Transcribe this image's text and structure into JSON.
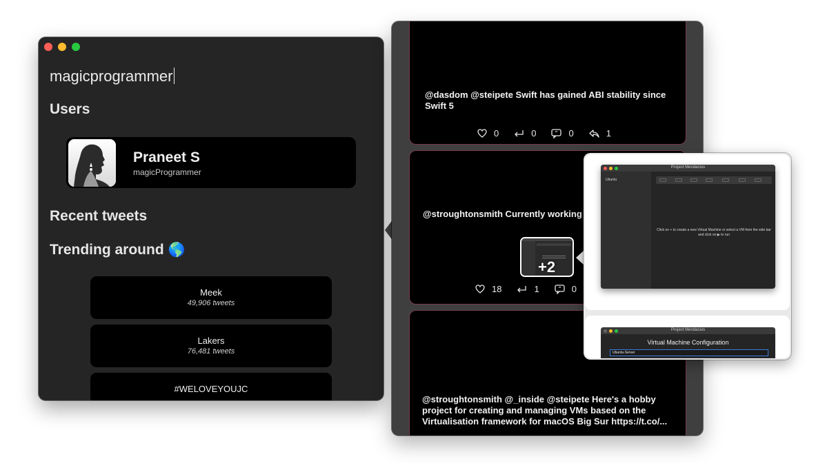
{
  "search": {
    "query": "magicprogrammer"
  },
  "sections": {
    "users": "Users",
    "recent_tweets": "Recent tweets",
    "trending": "Trending around",
    "trending_emoji": "🌎"
  },
  "user": {
    "name": "Praneet S",
    "handle": "magicProgrammer"
  },
  "trends": [
    {
      "name": "Meek",
      "count": "49,906 tweets"
    },
    {
      "name": "Lakers",
      "count": "76,481 tweets"
    },
    {
      "name": "#WELOVEYOUJC",
      "count": ""
    }
  ],
  "tweets": [
    {
      "text": "@dasdom @steipete Swift has gained ABI stability since Swift 5",
      "likes": "0",
      "retweets": "0",
      "quotes": "0",
      "replies": "1"
    },
    {
      "text": "@stroughtonsmith Currently working",
      "likes": "18",
      "retweets": "1",
      "quotes": "0",
      "media_more": "+2"
    },
    {
      "text": "@stroughtonsmith @_inside @steipete  Here's a hobby project for creating and managing VMs based on the Virtualisation framework for macOS Big Sur https://t.co/..."
    }
  ],
  "preview": {
    "window_title": "Project Mendacius",
    "sidebar_item": "Ubuntu",
    "empty_message": "Click on + to create a new Virtual Machine or select a VM from the side bar and click on ▶ to run",
    "config_window_title": "Project Mendacius",
    "config_heading": "Virtual Machine Configuration",
    "config_input_value": "Ubuntu-Server"
  },
  "colors": {
    "tweet_border": "#7a3a4c",
    "window_bg": "#252525",
    "accent_blue": "#3d7bd9"
  }
}
